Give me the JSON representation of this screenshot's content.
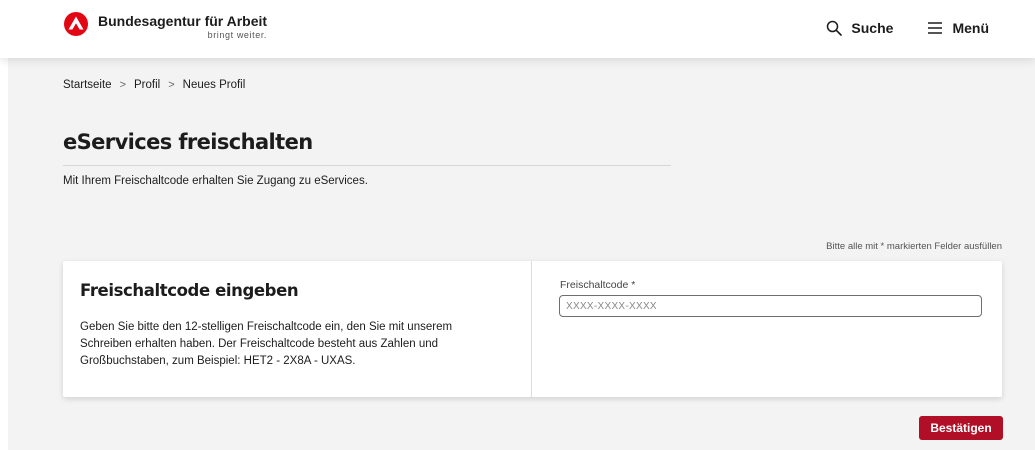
{
  "header": {
    "brand_title": "Bundesagentur für Arbeit",
    "brand_tagline": "bringt weiter.",
    "search_label": "Suche",
    "menu_label": "Menü",
    "brand_color": "#e30613"
  },
  "breadcrumb": {
    "items": [
      "Startseite",
      "Profil",
      "Neues Profil"
    ],
    "separator": ">"
  },
  "main": {
    "title": "eServices freischalten",
    "subtitle": "Mit Ihrem Freischaltcode erhalten Sie Zugang zu eServices.",
    "required_note": "Bitte alle mit * markierten Felder ausfüllen"
  },
  "card": {
    "title": "Freischaltcode eingeben",
    "description": "Geben Sie bitte den 12-stelligen Freischaltcode ein, den Sie mit unserem Schreiben erhalten haben. Der Freischaltcode besteht aus Zahlen und Großbuchstaben, zum Beispiel: HET2 - 2X8A - UXAS.",
    "field_label": "Freischaltcode *",
    "field_placeholder": "XXXX-XXXX-XXXX",
    "field_value": ""
  },
  "actions": {
    "submit_label": "Bestätigen",
    "submit_color": "#b10f27"
  },
  "icons": {
    "logo": "ba-logo-icon",
    "search": "search-icon",
    "menu": "hamburger-menu-icon"
  }
}
